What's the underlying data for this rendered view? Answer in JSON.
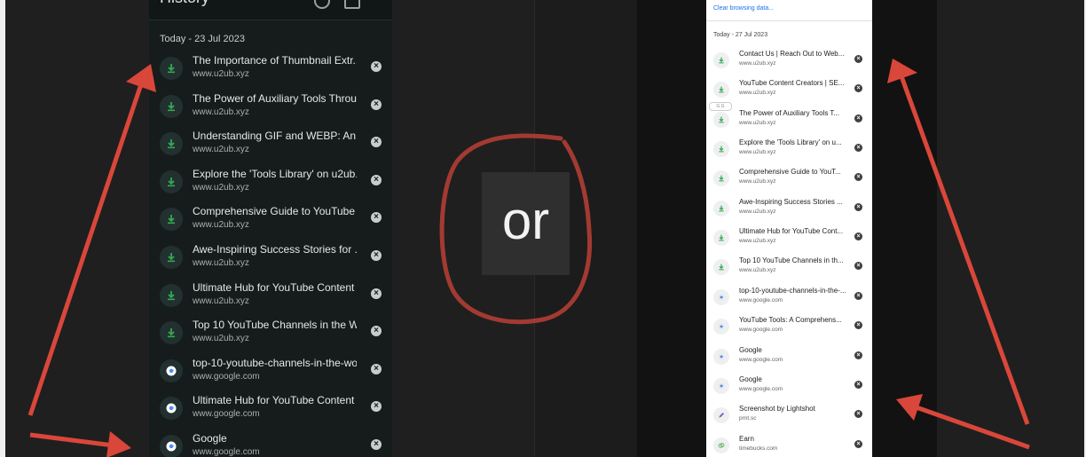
{
  "left_panel": {
    "title": "History",
    "date": "Today - 23 Jul 2023",
    "items": [
      {
        "title": "The Importance of Thumbnail Extr...",
        "url": "www.u2ub.xyz",
        "icon": "u2ub-icon"
      },
      {
        "title": "The Power of Auxiliary Tools Throu...",
        "url": "www.u2ub.xyz",
        "icon": "u2ub-icon"
      },
      {
        "title": "Understanding GIF and WEBP: An I...",
        "url": "www.u2ub.xyz",
        "icon": "u2ub-icon"
      },
      {
        "title": "Explore the 'Tools Library' on u2ub....",
        "url": "www.u2ub.xyz",
        "icon": "u2ub-icon"
      },
      {
        "title": "Comprehensive Guide to YouTube ...",
        "url": "www.u2ub.xyz",
        "icon": "u2ub-icon"
      },
      {
        "title": "Awe-Inspiring Success Stories for ...",
        "url": "www.u2ub.xyz",
        "icon": "u2ub-icon"
      },
      {
        "title": "Ultimate Hub for YouTube Content ...",
        "url": "www.u2ub.xyz",
        "icon": "u2ub-icon"
      },
      {
        "title": "Top 10 YouTube Channels in the W...",
        "url": "www.u2ub.xyz",
        "icon": "u2ub-icon"
      },
      {
        "title": "top-10-youtube-channels-in-the-wo...",
        "url": "www.google.com",
        "icon": "google-icon"
      },
      {
        "title": "Ultimate Hub for YouTube Content ...",
        "url": "www.google.com",
        "icon": "google-icon"
      },
      {
        "title": "Google",
        "url": "www.google.com",
        "icon": "google-icon"
      }
    ]
  },
  "center": {
    "label": "or"
  },
  "right_panel": {
    "clear_label": "Clear browsing data...",
    "date": "Today - 27 Jul 2023",
    "tag_label": "G G",
    "items": [
      {
        "title": "Contact Us | Reach Out to Web...",
        "url": "www.u2ub.xyz",
        "icon": "u2ub-icon"
      },
      {
        "title": "YouTube Content Creators | SE...",
        "url": "www.u2ub.xyz",
        "icon": "u2ub-icon"
      },
      {
        "title": "The Power of Auxiliary Tools T...",
        "url": "www.u2ub.xyz",
        "icon": "u2ub-icon"
      },
      {
        "title": "Explore the 'Tools Library' on u...",
        "url": "www.u2ub.xyz",
        "icon": "u2ub-icon"
      },
      {
        "title": "Comprehensive Guide to YouT...",
        "url": "www.u2ub.xyz",
        "icon": "u2ub-icon"
      },
      {
        "title": "Awe-Inspiring Success Stories ...",
        "url": "www.u2ub.xyz",
        "icon": "u2ub-icon"
      },
      {
        "title": "Ultimate Hub for YouTube Cont...",
        "url": "www.u2ub.xyz",
        "icon": "u2ub-icon"
      },
      {
        "title": "Top 10 YouTube Channels in th...",
        "url": "www.u2ub.xyz",
        "icon": "u2ub-icon"
      },
      {
        "title": "top-10-youtube-channels-in-the-...",
        "url": "www.google.com",
        "icon": "google-icon"
      },
      {
        "title": "YouTube Tools: A Comprehens...",
        "url": "www.google.com",
        "icon": "google-icon"
      },
      {
        "title": "Google",
        "url": "www.google.com",
        "icon": "google-icon"
      },
      {
        "title": "Google",
        "url": "www.google.com",
        "icon": "google-icon"
      },
      {
        "title": "Screenshot by Lightshot",
        "url": "prnt.sc",
        "icon": "pencil-icon"
      },
      {
        "title": "Earn",
        "url": "timebucks.com",
        "icon": "coins-icon"
      }
    ]
  },
  "colors": {
    "annotation_red": "#d9473a",
    "circle_red": "#a33a32",
    "u2ub_green": "#34a853",
    "link_blue": "#1a73e8"
  }
}
